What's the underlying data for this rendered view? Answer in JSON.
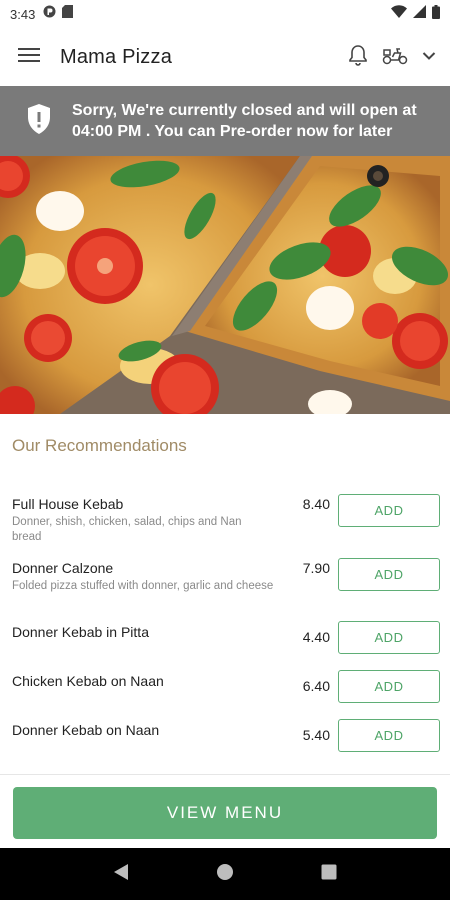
{
  "status_bar": {
    "time": "3:43",
    "icons": [
      "notification-icon",
      "sd-card-icon",
      "wifi-icon",
      "signal-icon",
      "battery-icon"
    ]
  },
  "app_bar": {
    "title": "Mama Pizza",
    "icons": [
      "hamburger-menu-icon",
      "bell-icon",
      "delivery-scooter-icon",
      "chevron-down-icon"
    ]
  },
  "banner": {
    "message": "Sorry, We're currently closed and will open at 04:00 PM . You can Pre-order now for later",
    "icon": "shield-alert-icon",
    "background": "#7a7a7a"
  },
  "hero": {
    "image": "pizza-photo"
  },
  "recommendations": {
    "title": "Our Recommendations",
    "add_label": "ADD",
    "items": [
      {
        "name": "Full House Kebab",
        "description": "Donner, shish, chicken, salad, chips and Nan bread",
        "price": "8.40"
      },
      {
        "name": "Donner Calzone",
        "description": "Folded pizza stuffed with donner, garlic and cheese",
        "price": "7.90"
      },
      {
        "name": "Donner Kebab in Pitta",
        "description": "",
        "price": "4.40"
      },
      {
        "name": "Chicken Kebab on Naan",
        "description": "",
        "price": "6.40"
      },
      {
        "name": "Donner Kebab on Naan",
        "description": "",
        "price": "5.40"
      }
    ]
  },
  "footer": {
    "view_menu_label": "VIEW MENU",
    "accent": "#5fae76"
  },
  "nav_bar": {
    "icons": [
      "back-icon",
      "home-icon",
      "recents-icon"
    ]
  }
}
